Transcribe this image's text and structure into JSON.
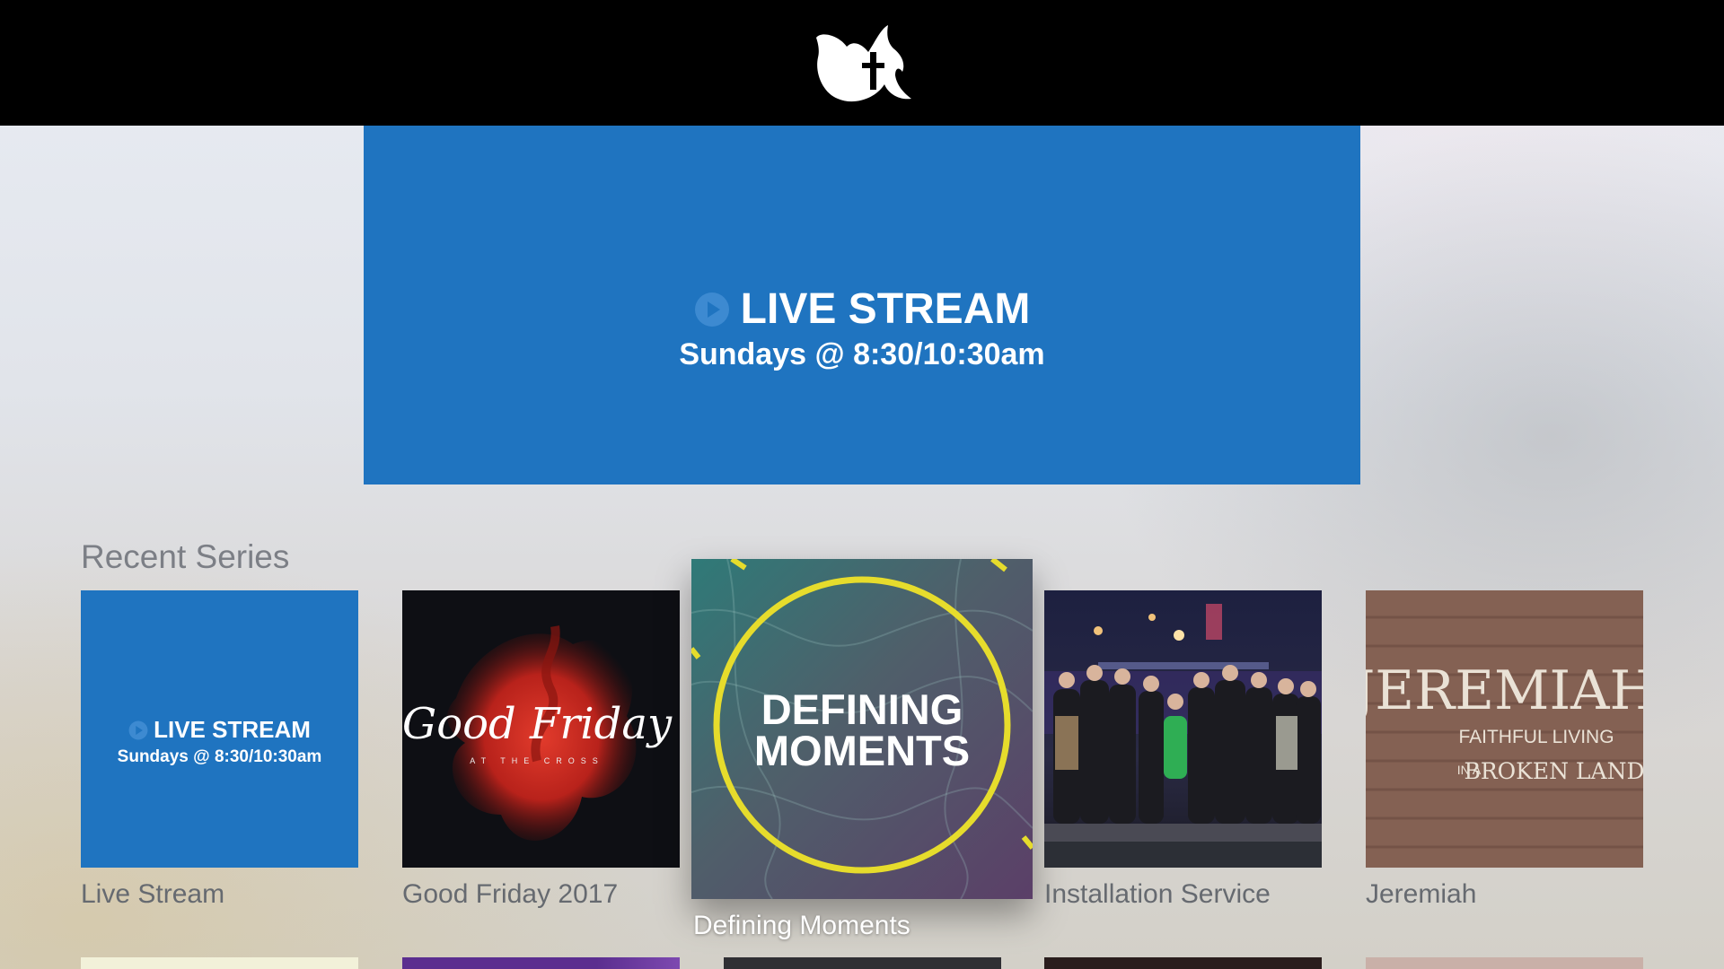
{
  "header": {
    "logo_icon": "dove-cross-logo-icon"
  },
  "featured": {
    "title": "LIVE STREAM",
    "subtitle": "Sundays @ 8:30/10:30am",
    "icon": "play-circle-icon",
    "background": "#1f74c0"
  },
  "section": {
    "title": "Recent Series"
  },
  "series": [
    {
      "label": "Live Stream",
      "art_title": "LIVE STREAM",
      "art_subtitle": "Sundays @ 8:30/10:30am"
    },
    {
      "label": "Good Friday  2017",
      "art_title": "Good Friday",
      "art_subtitle": "AT THE CROSS"
    },
    {
      "label": "Defining Moments",
      "art_line1": "DEFINING",
      "art_line2": "MOMENTS",
      "focused": true
    },
    {
      "label": "Installation Service"
    },
    {
      "label": "Jeremiah",
      "art_title": "JEREMIAH",
      "art_line1": "FAITHFUL LIVING",
      "art_line2_prefix": "IN A",
      "art_line2": "BROKEN LAND"
    }
  ],
  "colors": {
    "accent": "#1f74c0",
    "header": "#000000",
    "label": "#666a70",
    "focus_ring": "#e6dc2c"
  }
}
